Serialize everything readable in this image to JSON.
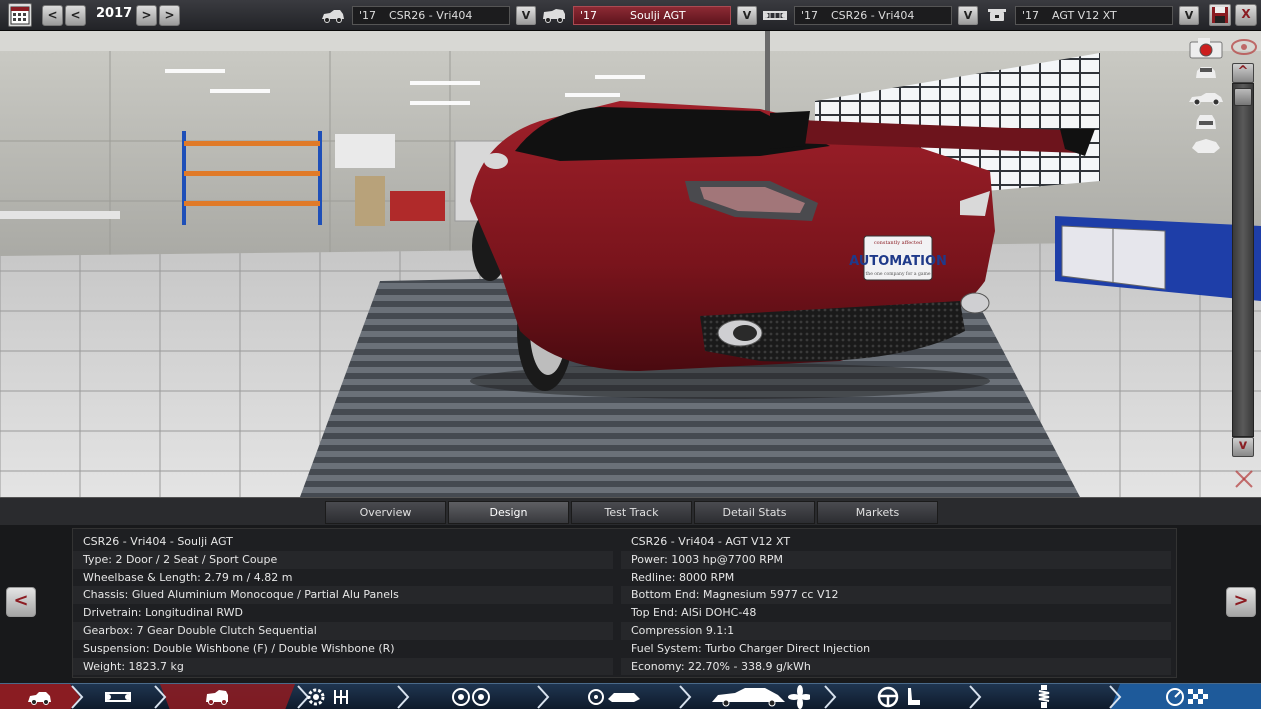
{
  "topbar": {
    "year": "2017",
    "selectors": [
      {
        "year": "'17",
        "name": "CSR26 - Vri404",
        "icon": "car-body-icon"
      },
      {
        "year": "'17",
        "name": "Soulji AGT",
        "icon": "car-trim-icon"
      },
      {
        "year": "'17",
        "name": "CSR26 - Vri404",
        "icon": "chassis-icon"
      },
      {
        "year": "'17",
        "name": "AGT V12 XT",
        "icon": "engine-icon"
      }
    ],
    "dropdown_glyph": "V",
    "prev_glyph": "<",
    "next_glyph": ">",
    "close_glyph": "X"
  },
  "scene": {
    "plate_text": "AUTOMATION",
    "plate_top": "constantly affected",
    "plate_bottom": "the one company for a game"
  },
  "scroll": {
    "up": "^",
    "down": "v"
  },
  "tabs": [
    "Overview",
    "Design",
    "Test Track",
    "Detail Stats",
    "Markets"
  ],
  "active_tab": "Design",
  "info": {
    "left": [
      "CSR26 - Vri404 - Soulji AGT",
      "Type: 2 Door / 2 Seat / Sport Coupe",
      "Wheelbase & Length: 2.79 m / 4.82 m",
      "Chassis: Glued Aluminium Monocoque / Partial Alu Panels",
      "Drivetrain: Longitudinal RWD",
      "Gearbox: 7 Gear Double Clutch Sequential",
      "Suspension: Double Wishbone (F) / Double Wishbone (R)",
      "Weight: 1823.7 kg"
    ],
    "right": [
      "CSR26 - Vri404 - AGT V12 XT",
      "Power: 1003 hp@7700 RPM",
      "Redline: 8000 RPM",
      "Bottom End: Magnesium 5977 cc V12",
      "Top End: AlSi DOHC-48",
      "Compression 9.1:1",
      "Fuel System: Turbo Charger Direct Injection",
      "Economy: 22.70% - 338.9 g/kWh"
    ],
    "prev": "<",
    "next": ">"
  },
  "nav": {
    "segments": [
      "car-icon",
      "chassis-icon",
      "body-icon",
      "engine-gear-icon",
      "wheels-icon",
      "fixture-icon",
      "aero-icon",
      "interior-icon",
      "suspension-icon",
      "test-icon"
    ],
    "active_index": 2,
    "accent": "#8a1c22"
  }
}
